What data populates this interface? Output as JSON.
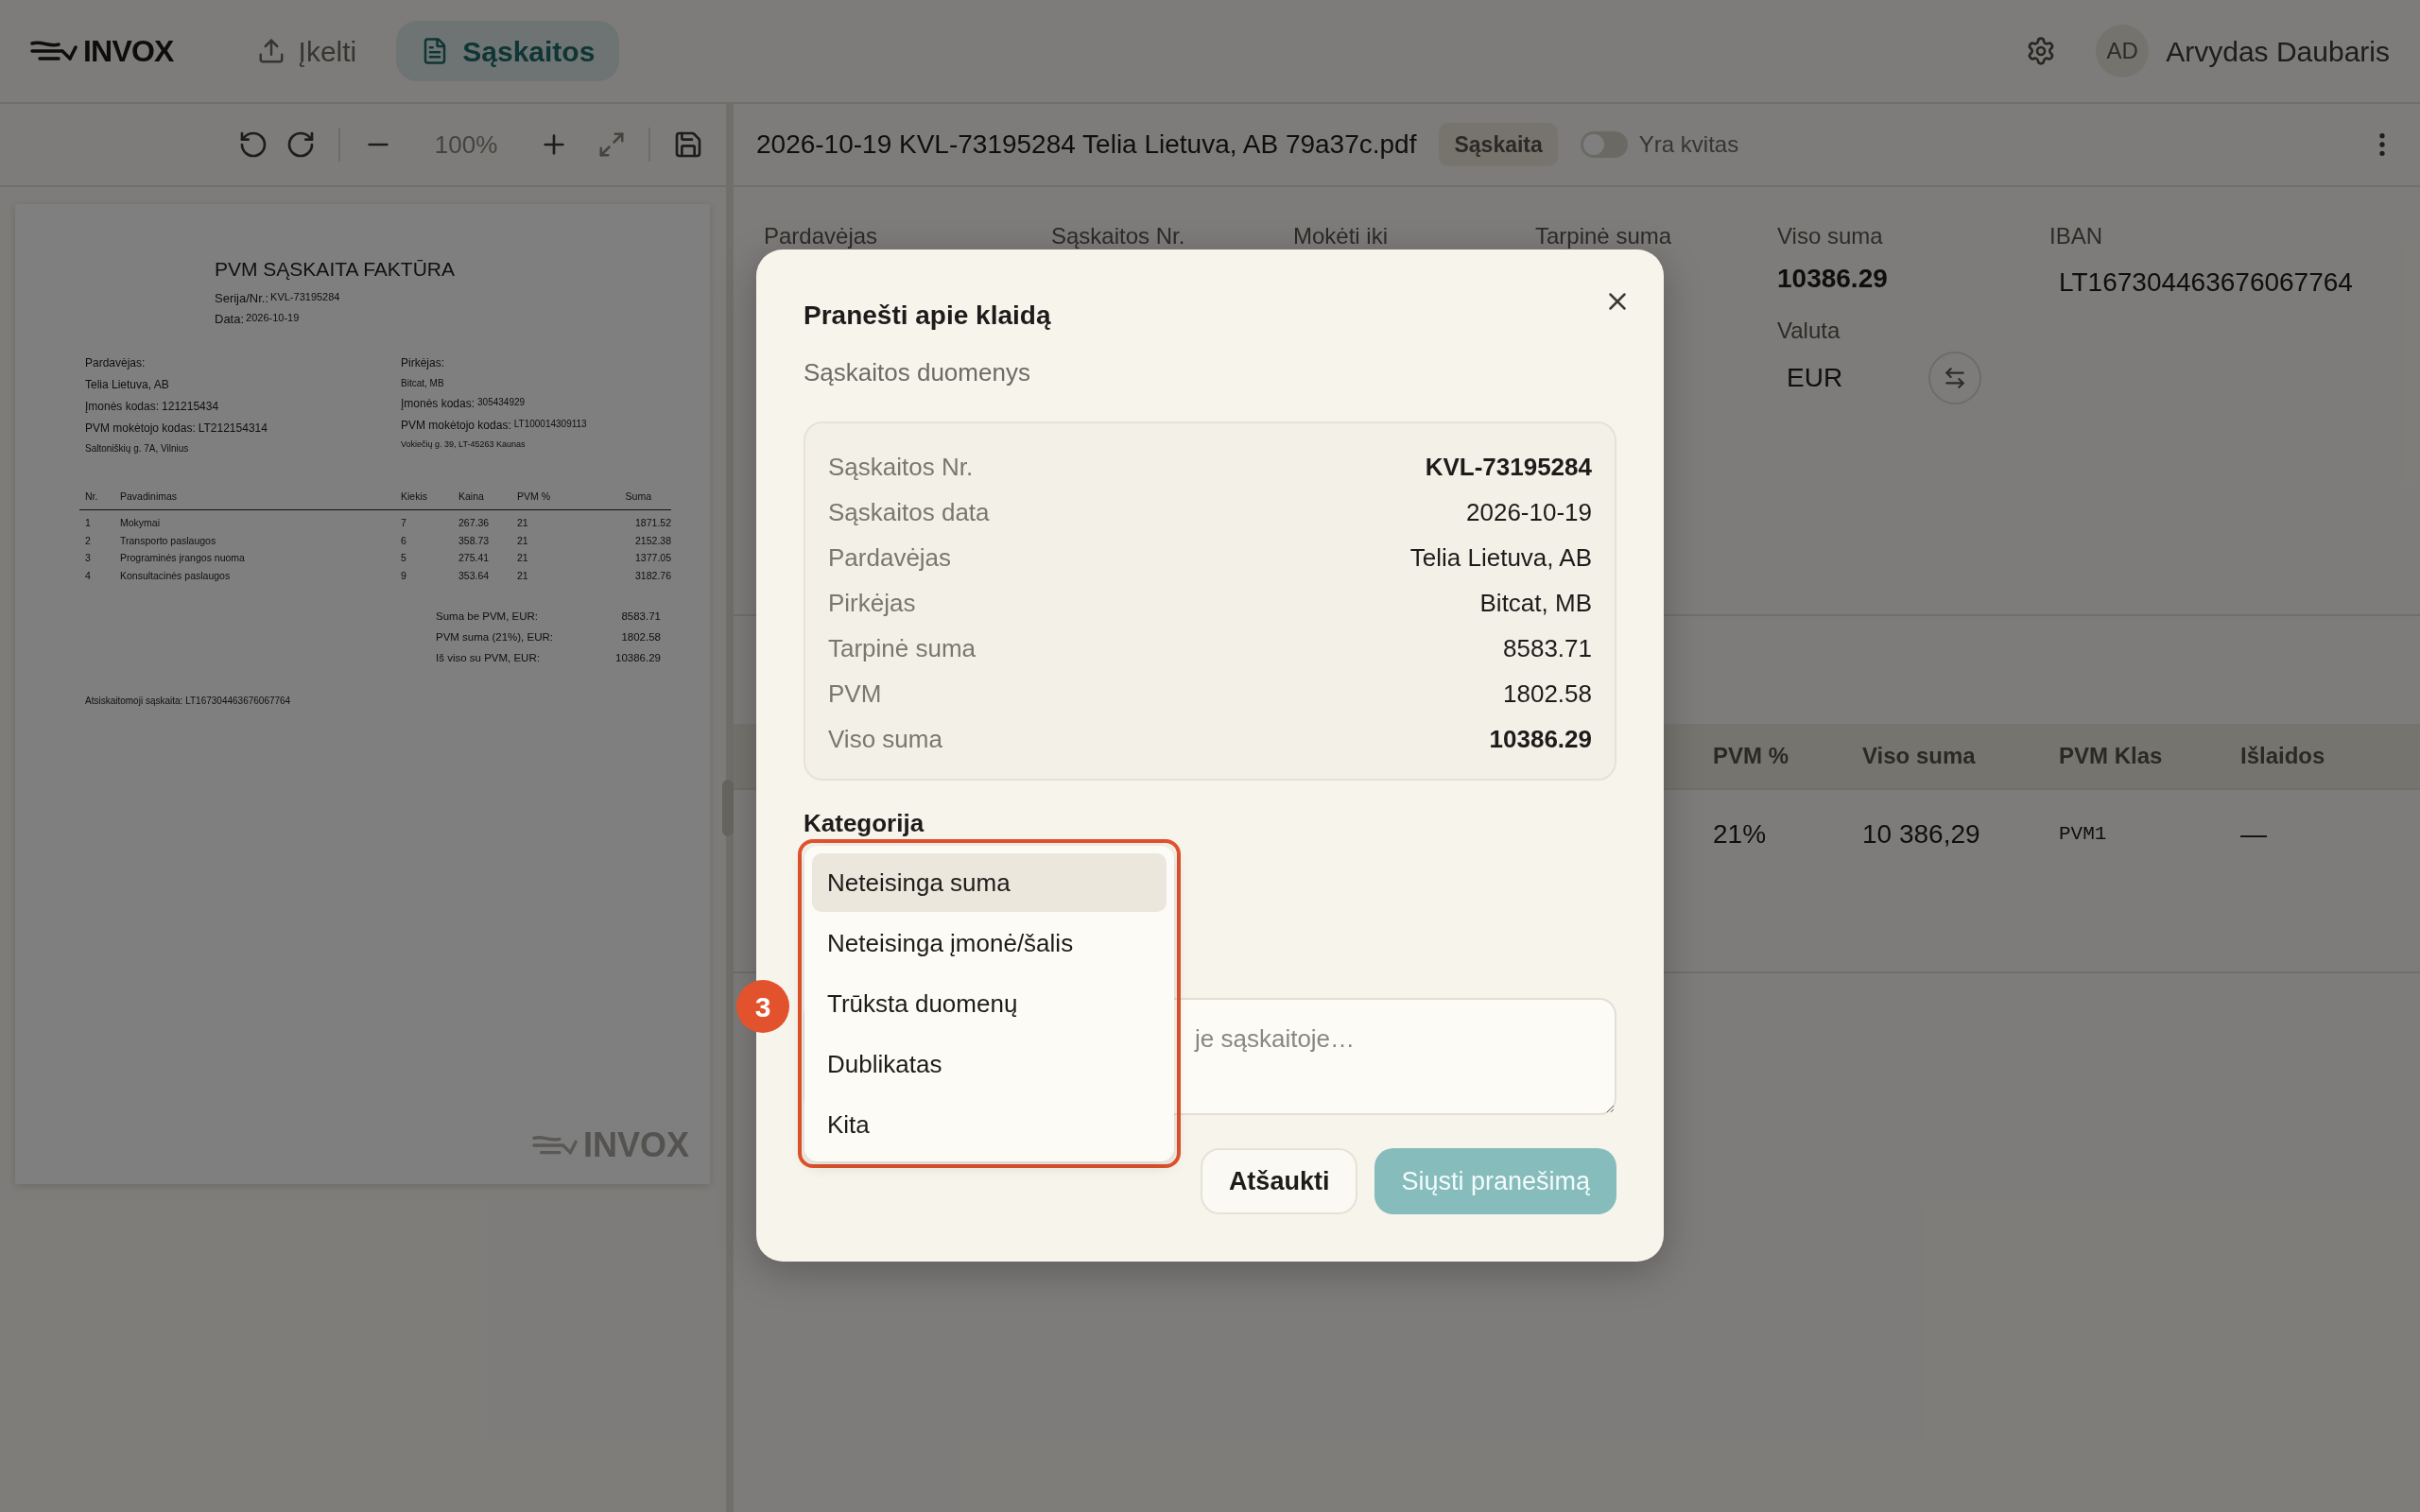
{
  "header": {
    "logo": "INVOX",
    "nav": [
      {
        "label": "Įkelti",
        "selected": false
      },
      {
        "label": "Sąskaitos",
        "selected": true
      }
    ],
    "user": {
      "initials": "AD",
      "name": "Arvydas Daubaris"
    }
  },
  "viewer": {
    "zoom": "100%",
    "document": {
      "title": "PVM SĄSKAITA FAKTŪRA",
      "meta": [
        {
          "label": "Serija/Nr.:",
          "value": "KVL-73195284"
        },
        {
          "label": "Data:",
          "value": "2026-10-19"
        }
      ],
      "seller": {
        "heading": "Pardavėjas:",
        "name": "Telia Lietuva, AB",
        "lines": [
          {
            "label": "Įmonės kodas:",
            "value": "121215434"
          },
          {
            "label": "PVM mokėtojo kodas:",
            "value": "LT212154314"
          }
        ],
        "address": "Saltoniškių g. 7A, Vilnius"
      },
      "buyer": {
        "heading": "Pirkėjas:",
        "name": "Bitcat, MB",
        "lines": [
          {
            "label": "Įmonės kodas:",
            "value": "305434929"
          },
          {
            "label": "PVM mokėtojo kodas:",
            "value": "LT100014309113"
          }
        ],
        "address": "Vokiečių g. 39, LT-45263 Kaunas"
      },
      "columns": [
        "Nr.",
        "Pavadinimas",
        "Kiekis",
        "Kaina",
        "PVM %",
        "Suma"
      ],
      "rows": [
        [
          "1",
          "Mokymai",
          "7",
          "267.36",
          "21",
          "1871.52"
        ],
        [
          "2",
          "Transporto paslaugos",
          "6",
          "358.73",
          "21",
          "2152.38"
        ],
        [
          "3",
          "Programinės įrangos nuoma",
          "5",
          "275.41",
          "21",
          "1377.05"
        ],
        [
          "4",
          "Konsultacinės paslaugos",
          "9",
          "353.64",
          "21",
          "3182.76"
        ]
      ],
      "totals": [
        {
          "label": "Suma be PVM, EUR:",
          "value": "8583.71"
        },
        {
          "label": "PVM suma (21%), EUR:",
          "value": "1802.58"
        },
        {
          "label": "Iš viso su PVM, EUR:",
          "value": "10386.29"
        }
      ],
      "footer": "Atsiskaitomoji sąskaita: LT167304463676067764",
      "watermark": "INVOX"
    }
  },
  "invoice_bar": {
    "filename": "2026-10-19 KVL-73195284 Telia Lietuva, AB 79a37c.pdf",
    "badge": "Sąskaita",
    "toggle": {
      "label": "Yra kvitas",
      "on": false
    }
  },
  "fields": [
    {
      "label": "Pardavėjas"
    },
    {
      "label": "Sąskaitos Nr."
    },
    {
      "label": "Mokėti iki"
    },
    {
      "label": "Tarpinė suma"
    },
    {
      "label": "Viso suma",
      "value": "10386.29",
      "sub": {
        "label": "Valuta",
        "value": "EUR"
      }
    },
    {
      "label": "IBAN",
      "value": "LT167304463676067764"
    }
  ],
  "lines_table": {
    "columns": [
      "PVM %",
      "Viso suma",
      "PVM Klas",
      "Išlaidos"
    ],
    "rows": [
      [
        "21%",
        "10 386,29",
        "PVM1",
        "—"
      ]
    ]
  },
  "dialog": {
    "title": "Pranešti apie klaidą",
    "subtitle": "Sąskaitos duomenys",
    "details": [
      {
        "label": "Sąskaitos Nr.",
        "value": "KVL-73195284",
        "bold": true
      },
      {
        "label": "Sąskaitos data",
        "value": "2026-10-19",
        "bold": false
      },
      {
        "label": "Pardavėjas",
        "value": "Telia Lietuva, AB",
        "bold": false
      },
      {
        "label": "Pirkėjas",
        "value": "Bitcat, MB",
        "bold": false
      },
      {
        "label": "Tarpinė suma",
        "value": "8583.71",
        "bold": false
      },
      {
        "label": "PVM",
        "value": "1802.58",
        "bold": false
      },
      {
        "label": "Viso suma",
        "value": "10386.29",
        "bold": true
      }
    ],
    "category_label": "Kategorija",
    "options": [
      {
        "label": "Neteisinga suma",
        "selected": true
      },
      {
        "label": "Neteisinga įmonė/šalis",
        "selected": false
      },
      {
        "label": "Trūksta duomenų",
        "selected": false
      },
      {
        "label": "Dublikatas",
        "selected": false
      },
      {
        "label": "Kita",
        "selected": false
      }
    ],
    "step_marker": "3",
    "textarea": {
      "placeholder": "je sąskaitoje…"
    },
    "buttons": [
      {
        "label": "Atšaukti",
        "kind": "secondary",
        "disabled": false
      },
      {
        "label": "Siųsti pranešimą",
        "kind": "primary",
        "disabled": true
      }
    ]
  }
}
